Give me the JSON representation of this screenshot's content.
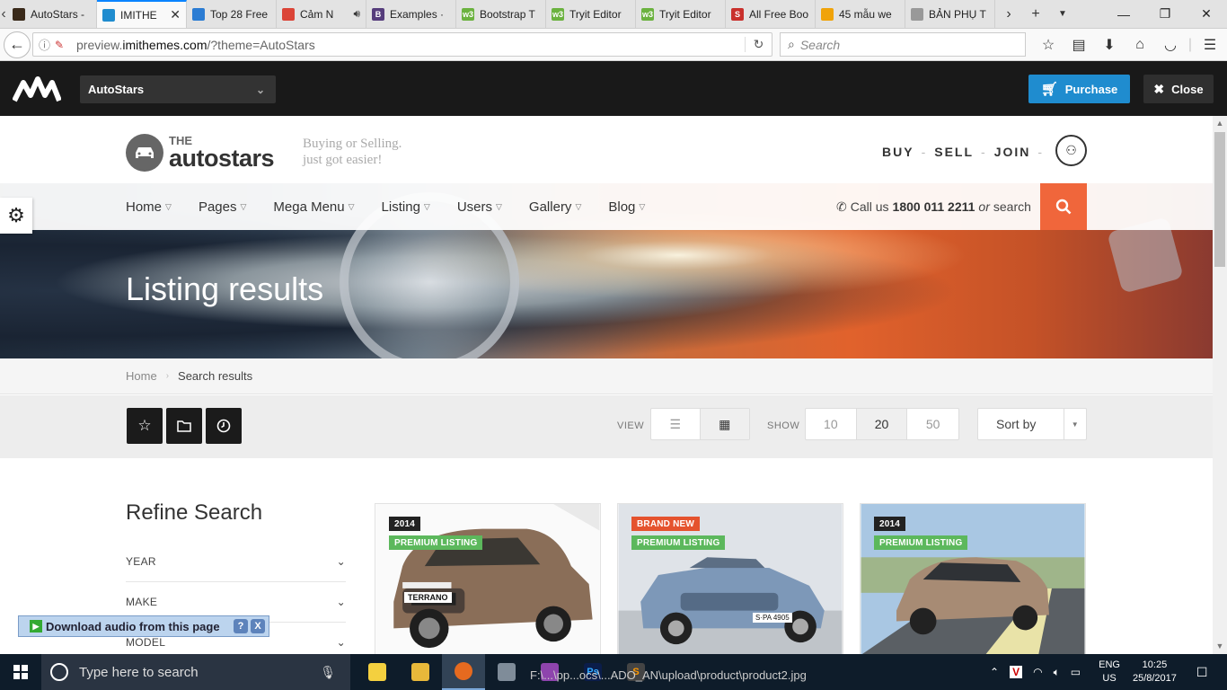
{
  "browser": {
    "tabs": [
      {
        "label": "AutoStars -",
        "color": "#3a2a1a",
        "glyph": ""
      },
      {
        "label": "IMITHE",
        "color": "#1f8ccf",
        "glyph": ""
      },
      {
        "label": "Top 28 Free",
        "color": "#2b7cd3",
        "glyph": ""
      },
      {
        "label": "Cảm N",
        "color": "#db4437",
        "glyph": ""
      },
      {
        "label": "Examples ·",
        "color": "#563d7c",
        "glyph": "B"
      },
      {
        "label": "Bootstrap T",
        "color": "#6bb23f",
        "glyph": "w3"
      },
      {
        "label": "Tryit Editor",
        "color": "#6bb23f",
        "glyph": "w3"
      },
      {
        "label": "Tryit Editor",
        "color": "#6bb23f",
        "glyph": "w3"
      },
      {
        "label": "All Free Boo",
        "color": "#c9302c",
        "glyph": "S"
      },
      {
        "label": "45 mẫu we",
        "color": "#f0a30a",
        "glyph": ""
      },
      {
        "label": "BẢN PHỤ T",
        "color": "#999999",
        "glyph": ""
      }
    ],
    "url_prefix": "preview.",
    "url_domain": "imithemes.com",
    "url_path": "/?theme=AutoStars",
    "search_placeholder": "Search"
  },
  "demo_bar": {
    "theme_name": "AutoStars",
    "purchase_label": "Purchase",
    "close_label": "Close"
  },
  "site": {
    "brand_the": "THE",
    "brand_name": "autostars",
    "tagline_1": "Buying or Selling.",
    "tagline_2": "just got easier!",
    "top_links": [
      "BUY",
      "SELL",
      "JOIN"
    ],
    "menu": [
      "Home",
      "Pages",
      "Mega Menu",
      "Listing",
      "Users",
      "Gallery",
      "Blog"
    ],
    "call_prefix": "Call us",
    "call_number": "1800 011 2211",
    "call_or": "or",
    "call_suffix": "search",
    "page_title": "Listing results",
    "breadcrumb": {
      "home": "Home",
      "current": "Search results"
    },
    "tools": {
      "view_label": "VIEW",
      "show_label": "SHOW",
      "show_options": [
        "10",
        "20",
        "50"
      ],
      "show_selected": "20",
      "sort_label": "Sort by"
    },
    "refine_title": "Refine Search",
    "filters": [
      "YEAR",
      "MAKE",
      "MODEL"
    ],
    "cards": [
      {
        "tags": [
          {
            "text": "2014",
            "style": "dark"
          },
          {
            "text": "PREMIUM LISTING",
            "style": "green"
          }
        ],
        "plate": "TERRANO"
      },
      {
        "tags": [
          {
            "text": "BRAND NEW",
            "style": "red"
          },
          {
            "text": "PREMIUM LISTING",
            "style": "green"
          }
        ],
        "plate": "S·PA 4905"
      },
      {
        "tags": [
          {
            "text": "2014",
            "style": "dark"
          },
          {
            "text": "PREMIUM LISTING",
            "style": "green"
          }
        ],
        "plate": ""
      }
    ]
  },
  "popup": {
    "label": "Download audio from this page",
    "help": "?",
    "close": "X"
  },
  "taskbar": {
    "search_placeholder": "Type here to search",
    "tooltip": "F:\\...\\pp...ocs\\...ADO_AN\\upload\\product\\product2.jpg",
    "lang_1": "ENG",
    "lang_2": "US",
    "time": "10:25",
    "date": "25/8/2017"
  },
  "colors": {
    "accent_orange": "#f0663b",
    "purchase_blue": "#1f8ccf",
    "premium_green": "#5cb85c",
    "brand_new_red": "#e5532e"
  }
}
